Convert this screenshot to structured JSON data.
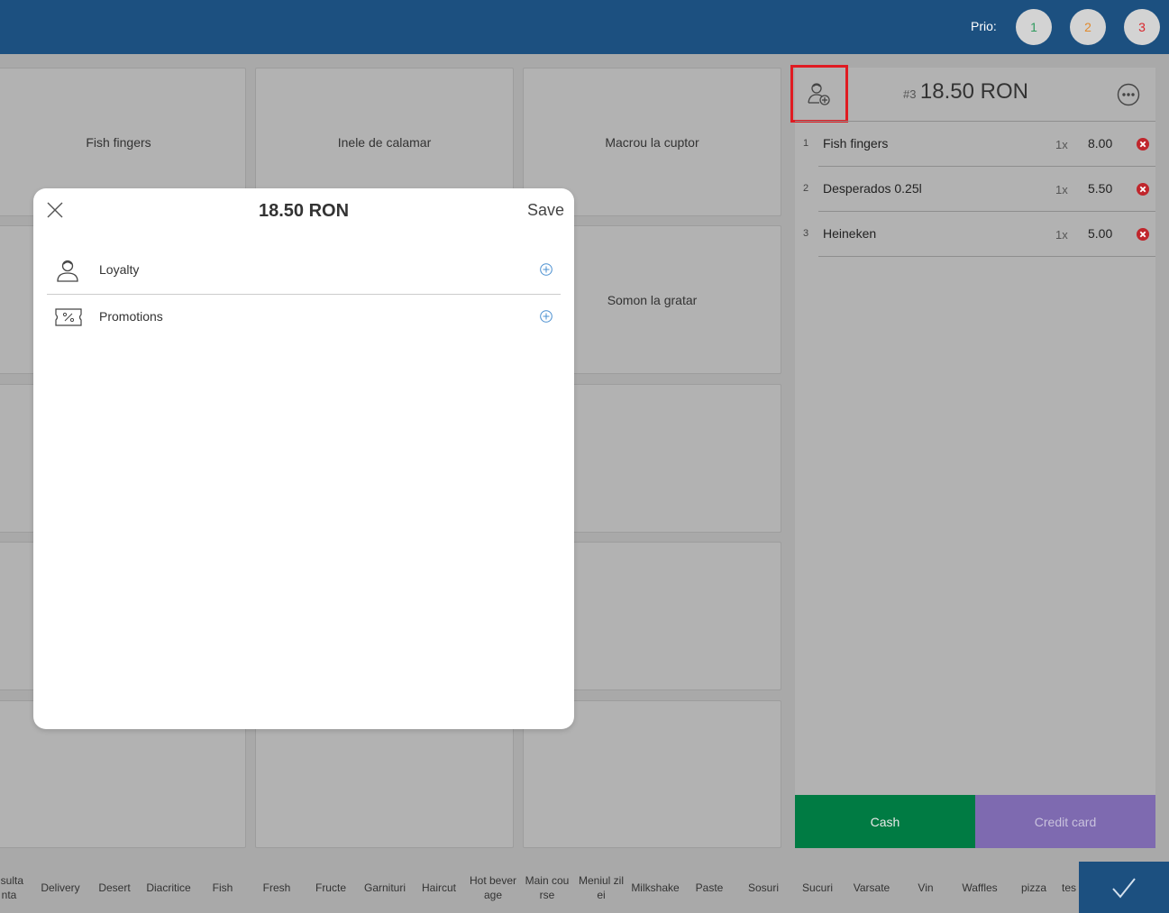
{
  "topbar": {
    "prio_label": "Prio:",
    "prio_buttons": [
      {
        "label": "1",
        "color": "#2e9a5e"
      },
      {
        "label": "2",
        "color": "#e08a2e"
      },
      {
        "label": "3",
        "color": "#d9262c"
      }
    ]
  },
  "products": {
    "tiles": [
      "Fish fingers",
      "Inele de calamar",
      "Macrou la cuptor",
      "Somon la gratar"
    ]
  },
  "order": {
    "number": "#3",
    "total": "18.50 RON",
    "items": [
      {
        "index": "1",
        "name": "Fish fingers",
        "qty": "1x",
        "price": "8.00"
      },
      {
        "index": "2",
        "name": "Desperados 0.25l",
        "qty": "1x",
        "price": "5.50"
      },
      {
        "index": "3",
        "name": "Heineken",
        "qty": "1x",
        "price": "5.00"
      }
    ],
    "cash_label": "Cash",
    "credit_card_label": "Credit card",
    "icons": {
      "customer": "add-customer-icon",
      "more": "more-options-icon",
      "remove": "remove-item-icon"
    }
  },
  "categories": [
    "nsulta\nnta",
    "Delivery",
    "Desert",
    "Diacritice",
    "Fish",
    "Fresh",
    "Fructe",
    "Garnituri",
    "Haircut",
    "Hot bever\nage",
    "Main cou\nrse",
    "Meniul zil\nei",
    "Milkshake",
    "Paste",
    "Sosuri",
    "Sucuri",
    "Varsate",
    "Vin",
    "Waffles",
    "pizza",
    "tes"
  ],
  "modal": {
    "title": "18.50 RON",
    "save_label": "Save",
    "rows": [
      {
        "label": "Loyalty",
        "icon": "loyalty-person-icon"
      },
      {
        "label": "Promotions",
        "icon": "promotion-ticket-icon"
      }
    ]
  },
  "colors": {
    "topbar": "#1c5080",
    "cash": "#007b43",
    "credit_card": "#7e6ab0",
    "highlight": "#e01b22",
    "remove": "#c0262c"
  }
}
